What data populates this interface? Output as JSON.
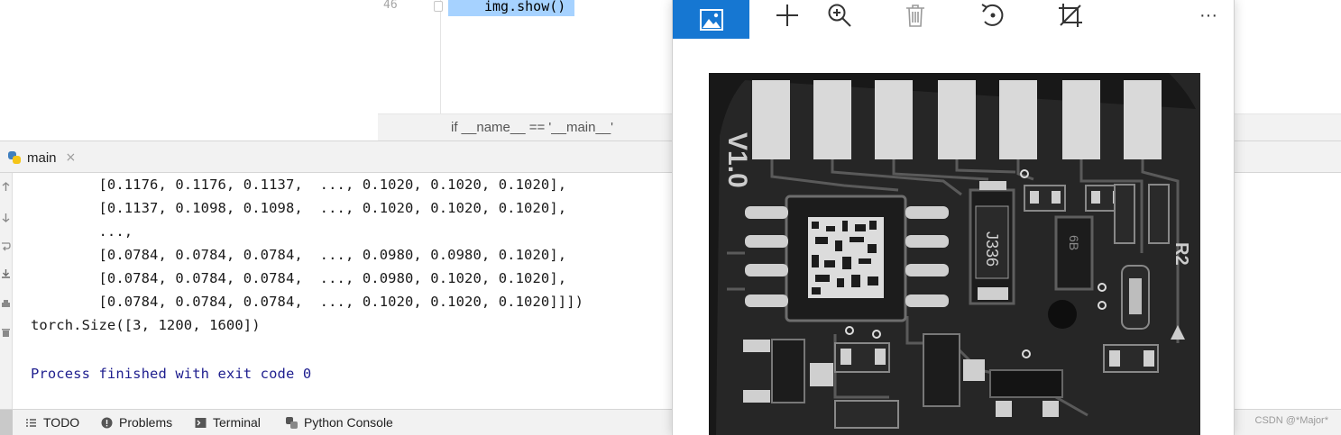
{
  "editor": {
    "line_number": "46",
    "code": "img.show()",
    "breadcrumb": "if __name__ == '__main__'"
  },
  "run_panel": {
    "tab_label": "main",
    "tab_close": "×",
    "console_lines": [
      "        [0.1176, 0.1176, 0.1137,  ..., 0.1020, 0.1020, 0.1020],",
      "        [0.1137, 0.1098, 0.1098,  ..., 0.1020, 0.1020, 0.1020],",
      "        ...,",
      "        [0.0784, 0.0784, 0.0784,  ..., 0.0980, 0.0980, 0.1020],",
      "        [0.0784, 0.0784, 0.0784,  ..., 0.0980, 0.1020, 0.1020],",
      "        [0.0784, 0.0784, 0.0784,  ..., 0.1020, 0.1020, 0.1020]]])",
      "torch.Size([3, 1200, 1600])"
    ],
    "exit_message": "Process finished with exit code 0"
  },
  "bottom_toolbar": {
    "todo": "TODO",
    "problems": "Problems",
    "terminal": "Terminal",
    "python_console": "Python Console",
    "watermark": "CSDN @*Major*"
  },
  "viewer": {
    "toolbar_icons": [
      "image-icon",
      "add-icon",
      "zoom-in-icon",
      "delete-icon",
      "rotate-icon",
      "crop-icon",
      "more-icon"
    ],
    "more_label": "···",
    "pcb_labels": {
      "version": "V1.0",
      "chip_code": "J336",
      "chip_code_2": "6B",
      "marking": "R2"
    }
  },
  "colors": {
    "accent": "#1677d2",
    "selection": "#a6d2ff",
    "exit_text": "#1f1f8f",
    "panel_bg": "#f2f2f2"
  }
}
